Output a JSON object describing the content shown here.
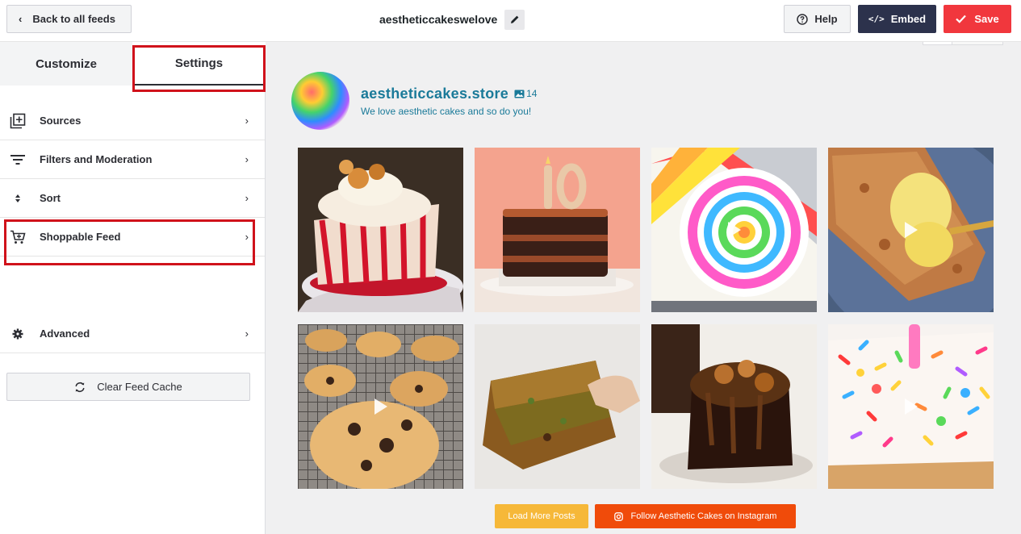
{
  "topbar": {
    "back_label": "Back to all feeds",
    "feed_name": "aestheticcakeswelove",
    "help_label": "Help",
    "embed_label": "Embed",
    "save_label": "Save",
    "colors": {
      "embed": "#2c324c",
      "save": "#f1373d"
    }
  },
  "sidebar": {
    "tabs": [
      {
        "label": "Customize",
        "active": false
      },
      {
        "label": "Settings",
        "active": true
      }
    ],
    "items": [
      {
        "label": "Sources",
        "icon": "add-source-icon"
      },
      {
        "label": "Filters and Moderation",
        "icon": "filter-icon"
      },
      {
        "label": "Sort",
        "icon": "sort-icon"
      },
      {
        "label": "Shoppable Feed",
        "icon": "cart-icon"
      },
      {
        "label": "Advanced",
        "icon": "gear-icon"
      }
    ],
    "clear_cache_label": "Clear Feed Cache",
    "highlight_color": "#d0121b"
  },
  "preview": {
    "username": "aestheticcakes.store",
    "media_count": "14",
    "bio": "We love aesthetic cakes and so do you!",
    "accent_color": "#1a7a99",
    "posts": [
      {
        "subject": "strawberry cheesecake slice",
        "video": false
      },
      {
        "subject": "chocolate birthday cake with 10 candle",
        "video": false
      },
      {
        "subject": "rainbow swiss roll",
        "video": true
      },
      {
        "subject": "apple crumble with custard",
        "video": true
      },
      {
        "subject": "chocolate chip cookies on rack",
        "video": true
      },
      {
        "subject": "pumpkin blondie bar",
        "video": false
      },
      {
        "subject": "caramel pecan brownie",
        "video": false
      },
      {
        "subject": "sprinkle birthday cake",
        "video": true
      }
    ],
    "load_more_label": "Load More Posts",
    "follow_label": "Follow Aesthetic Cakes on Instagram",
    "button_colors": {
      "load_more": "#f6b839",
      "follow": "#f04b0a"
    }
  }
}
